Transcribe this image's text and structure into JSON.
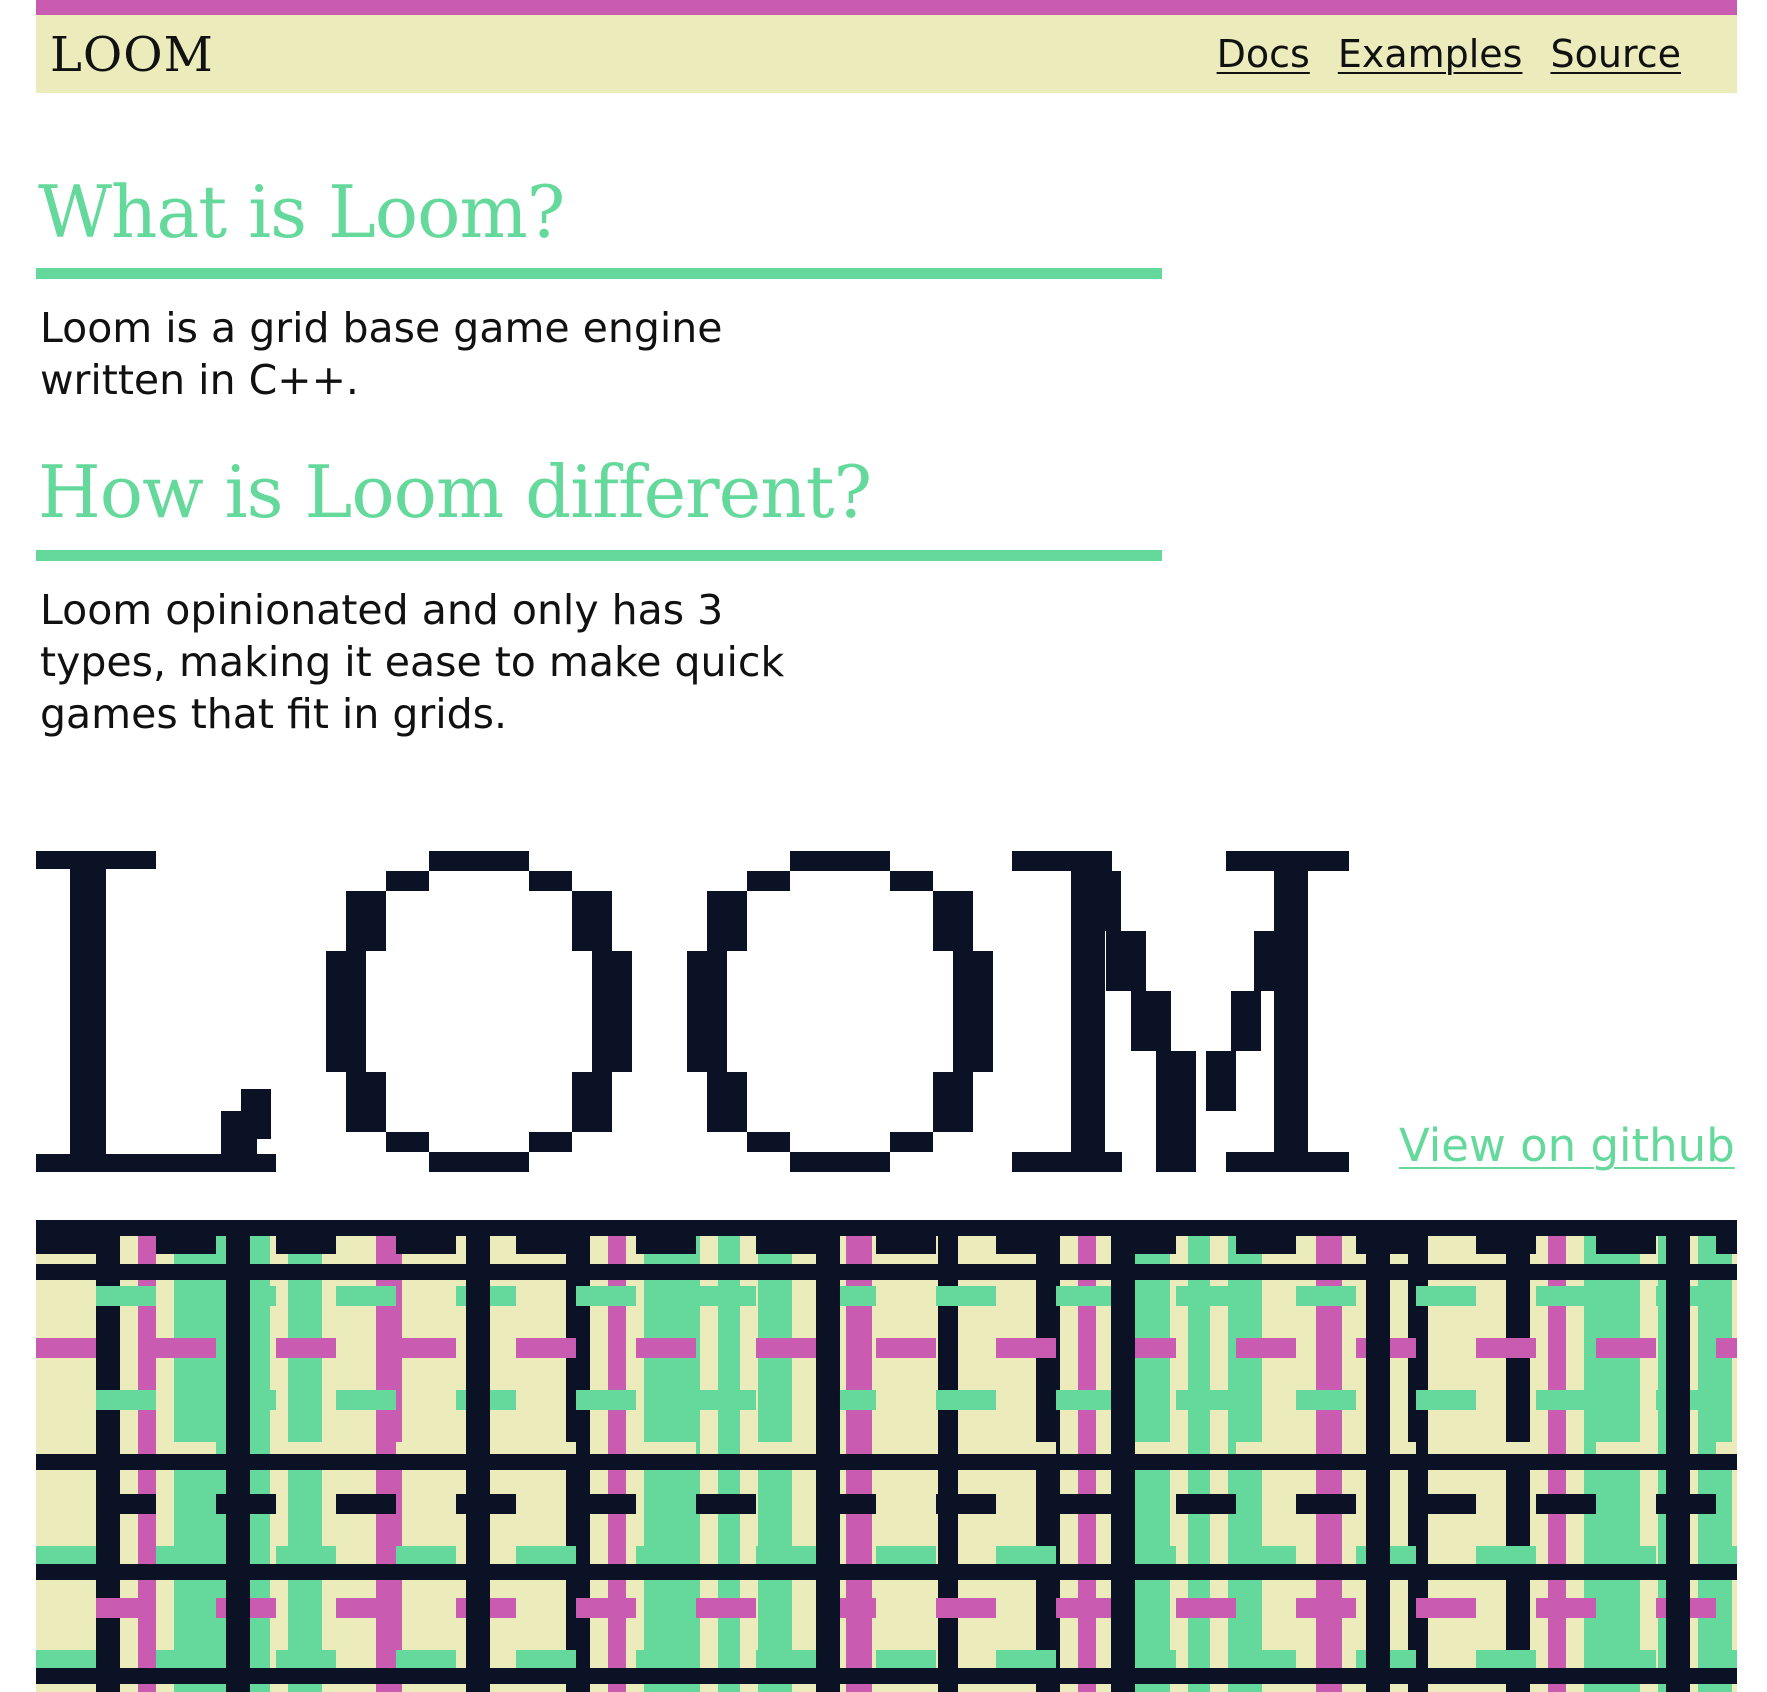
{
  "nav": {
    "logo": "LOOM",
    "links": [
      "Docs",
      "Examples",
      "Source"
    ]
  },
  "sections": [
    {
      "heading": "What is Loom?",
      "body": "Loom is a grid base game engine written in C++."
    },
    {
      "heading": "How is Loom different?",
      "body": "Loom opinionated and only has 3 types, making it ease to make quick games that fit in grids."
    }
  ],
  "hero": {
    "wordmark": "LOOM",
    "github_link": "View on github"
  },
  "colors": {
    "magenta": "#c95bb0",
    "cream": "#ebebbc",
    "green": "#65d99b",
    "navy": "#0b1226",
    "white": "#ffffff"
  },
  "icons": [
    "loom-pixel-wordmark",
    "woven-pattern-banner"
  ]
}
